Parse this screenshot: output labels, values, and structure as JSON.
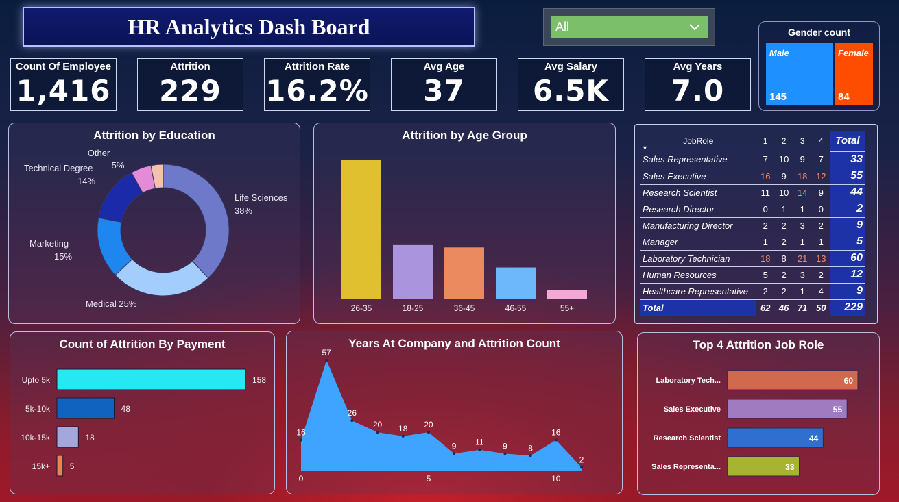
{
  "header": {
    "title": "HR Analytics Dash Board"
  },
  "filter": {
    "selected": "All",
    "chevron_icon": "chevron-down-icon"
  },
  "gender": {
    "title": "Gender count",
    "male": {
      "label": "Male",
      "value": "145",
      "color": "#1e90ff"
    },
    "female": {
      "label": "Female",
      "value": "84",
      "color": "#ff4d00"
    }
  },
  "kpis": [
    {
      "label": "Count Of Employee",
      "value": "1,416"
    },
    {
      "label": "Attrition",
      "value": "229"
    },
    {
      "label": "Attrition Rate",
      "value": "16.2%"
    },
    {
      "label": "Avg Age",
      "value": "37"
    },
    {
      "label": "Avg Salary",
      "value": "6.5K"
    },
    {
      "label": "Avg Years",
      "value": "7.0"
    }
  ],
  "education": {
    "title": "Attrition by Education",
    "chart_data": {
      "type": "pie",
      "slices": [
        {
          "name": "Life Sciences",
          "label": "Life Sciences",
          "pct_label": "38%",
          "value": 38,
          "color": "#6e79c9"
        },
        {
          "name": "Medical",
          "label": "Medical 25%",
          "pct_label": "",
          "value": 25,
          "color": "#a3cdfd"
        },
        {
          "name": "Marketing",
          "label": "Marketing",
          "pct_label": "15%",
          "value": 15,
          "color": "#1f86f0"
        },
        {
          "name": "Technical Degree",
          "label": "Technical Degree",
          "pct_label": "14%",
          "value": 14,
          "color": "#1a2aa8"
        },
        {
          "name": "Other",
          "label": "Other",
          "pct_label": "5%",
          "value": 5,
          "color": "#e58ad6"
        },
        {
          "name": "Other2",
          "label": "",
          "pct_label": "",
          "value": 3,
          "color": "#f6c1ac"
        }
      ]
    }
  },
  "age": {
    "title": "Attrition by Age Group",
    "chart_data": {
      "type": "bar",
      "categories": [
        "26-35",
        "18-25",
        "36-45",
        "46-55",
        "55+"
      ],
      "values": [
        118,
        46,
        44,
        27,
        8
      ],
      "colors": [
        "#e1c02f",
        "#a994dd",
        "#ea8a5e",
        "#6db7fb",
        "#f3a8d5"
      ]
    }
  },
  "matrix": {
    "header": {
      "label": "JobRole",
      "cols": [
        "1",
        "2",
        "3",
        "4"
      ],
      "total": "Total"
    },
    "rows": [
      {
        "role": "Sales Representative",
        "v": [
          "7",
          "10",
          "9",
          "7"
        ],
        "total": "33"
      },
      {
        "role": "Sales Executive",
        "v": [
          "16",
          "9",
          "18",
          "12"
        ],
        "total": "55"
      },
      {
        "role": "Research Scientist",
        "v": [
          "11",
          "10",
          "14",
          "9"
        ],
        "total": "44"
      },
      {
        "role": "Research Director",
        "v": [
          "0",
          "1",
          "1",
          "0"
        ],
        "total": "2"
      },
      {
        "role": "Manufacturing Director",
        "v": [
          "2",
          "2",
          "3",
          "2"
        ],
        "total": "9"
      },
      {
        "role": "Manager",
        "v": [
          "1",
          "2",
          "1",
          "1"
        ],
        "total": "5"
      },
      {
        "role": "Laboratory Technician",
        "v": [
          "18",
          "8",
          "21",
          "13"
        ],
        "total": "60"
      },
      {
        "role": "Human Resources",
        "v": [
          "5",
          "2",
          "3",
          "2"
        ],
        "total": "12"
      },
      {
        "role": "Healthcare Representative",
        "v": [
          "2",
          "2",
          "1",
          "4"
        ],
        "total": "9"
      }
    ],
    "totals": {
      "label": "Total",
      "v": [
        "62",
        "46",
        "71",
        "50"
      ],
      "total": "229"
    }
  },
  "payment": {
    "title": "Count of Attrition By Payment",
    "chart_data": {
      "type": "bar",
      "categories": [
        "Upto 5k",
        "5k-10k",
        "10k-15k",
        "15k+"
      ],
      "values": [
        158,
        48,
        18,
        5
      ],
      "colors": [
        "#26e8f2",
        "#1064c0",
        "#a3a7dc",
        "#e88352"
      ]
    }
  },
  "years": {
    "title": "Years At Company and Attrition Count",
    "chart_data": {
      "type": "area",
      "x": [
        0,
        1,
        2,
        3,
        4,
        5,
        6,
        7,
        8,
        9,
        10,
        11
      ],
      "values": [
        16,
        57,
        26,
        20,
        18,
        20,
        9,
        11,
        9,
        8,
        16,
        2
      ],
      "x_ticks": [
        "0",
        "5",
        "10"
      ],
      "color": "#3fa4ff"
    }
  },
  "toproles": {
    "title": "Top 4 Attrition Job Role",
    "chart_data": {
      "type": "bar",
      "categories": [
        "Laboratory Tech...",
        "Sales Executive",
        "Research Scientist",
        "Sales Representa..."
      ],
      "values": [
        60,
        55,
        44,
        33
      ],
      "colors": [
        "#d0694e",
        "#a07bc0",
        "#2e6fd0",
        "#a9b332"
      ]
    }
  }
}
